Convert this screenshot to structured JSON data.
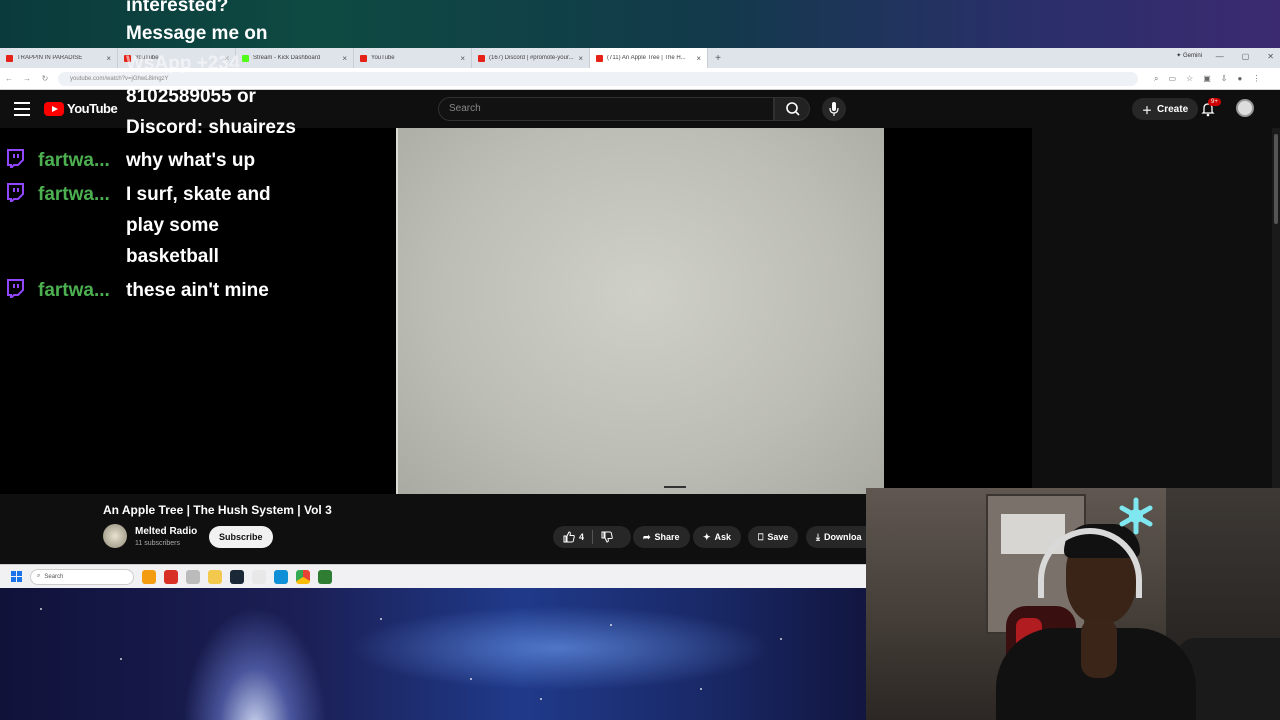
{
  "browser": {
    "tabs": [
      {
        "label": "TRAPPIN IN PARADISE",
        "color": "#e62117",
        "active": false
      },
      {
        "label": "YouTube",
        "color": "#e62117",
        "active": false
      },
      {
        "label": "Stream - Kick Dashboard",
        "color": "#53fc18",
        "active": false
      },
      {
        "label": "YouTube",
        "color": "#e62117",
        "active": false
      },
      {
        "label": "(167) Discord | #promote-your...",
        "color": "#e62117",
        "active": false
      },
      {
        "label": "(711) An Apple Tree | The H...",
        "color": "#e62117",
        "active": true
      }
    ],
    "new_tab": "+",
    "gemini": "Gemini",
    "url": "youtube.com/watch?v=jGhwL8imgzY"
  },
  "youtube": {
    "logo_text": "YouTube",
    "search_placeholder": "Search",
    "create_label": "Create",
    "notification_count": "9+",
    "video": {
      "title": "An Apple Tree | The Hush System | Vol 3",
      "channel": "Melted Radio",
      "subscribers": "11 subscribers",
      "subscribe_label": "Subscribe",
      "likes": "4",
      "share_label": "Share",
      "ask_label": "Ask",
      "save_label": "Save",
      "download_label": "Downloa"
    }
  },
  "taskbar": {
    "search_placeholder": "Search"
  },
  "chat": {
    "header_lines": [
      "interested?",
      "Message me on",
      "WsApp +234",
      "8102589055 or",
      "Discord: shuairezs"
    ],
    "messages": [
      {
        "user": "fartwa...",
        "lines": [
          "why what's up"
        ]
      },
      {
        "user": "fartwa...",
        "lines": [
          "I surf, skate and",
          "play some",
          "basketball"
        ]
      },
      {
        "user": "fartwa...",
        "lines": [
          "these ain't mine"
        ]
      }
    ]
  },
  "colors": {
    "yt_red": "#ff0000",
    "twitch_purple": "#9146ff",
    "chat_user_green": "#4caf50"
  }
}
